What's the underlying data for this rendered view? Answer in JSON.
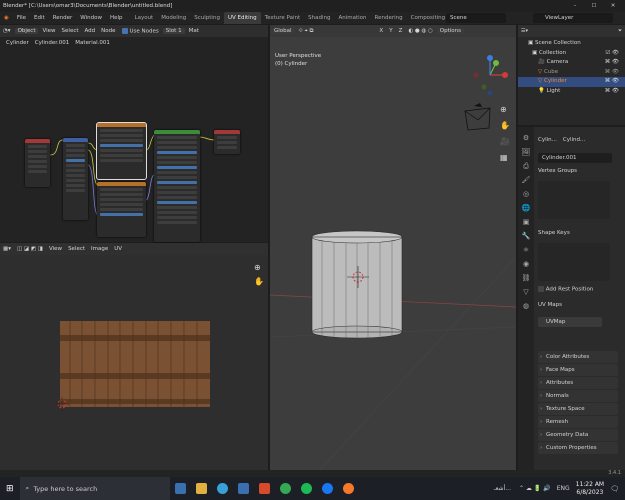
{
  "titlebar": {
    "title": "Blender* [C:\\Users\\omar3\\Documents\\Blender\\untitled.blend]"
  },
  "menu": [
    "File",
    "Edit",
    "Render",
    "Window",
    "Help"
  ],
  "workspaces": [
    "Layout",
    "Modeling",
    "Sculpting",
    "UV Editing",
    "Texture Paint",
    "Shading",
    "Animation",
    "Rendering",
    "Compositing"
  ],
  "scene": "Scene",
  "view_layer": "ViewLayer",
  "node_header": {
    "mode": "Object",
    "items": [
      "View",
      "Select",
      "Add",
      "Node"
    ],
    "use_nodes": "Use Nodes",
    "slot": "Slot 1",
    "mat": "Mat"
  },
  "breadcrumb": [
    "Cylinder",
    "Cylinder.001",
    "Material.001"
  ],
  "uv_header": {
    "items": [
      "View",
      "Select",
      "Image",
      "UV"
    ]
  },
  "viewport": {
    "title": "User Perspective",
    "object": "(0) Cylinder",
    "orientation": "Global",
    "options": "Options",
    "axes": [
      "X",
      "Y",
      "Z"
    ]
  },
  "outliner": {
    "collection_root": "Scene Collection",
    "collection": "Collection",
    "items": [
      "Camera",
      "Cube",
      "Cylinder",
      "Light"
    ]
  },
  "props": {
    "crumb": [
      "Cylin...",
      "Cylind..."
    ],
    "mesh_name": "Cylinder.001",
    "vertex_groups": "Vertex Groups",
    "shape_keys": "Shape Keys",
    "add_rest": "Add Rest Position",
    "uv_maps": "UV Maps",
    "uv_map_name": "UVMap",
    "panels": [
      "Color Attributes",
      "Face Maps",
      "Attributes",
      "Normals",
      "Texture Space",
      "Remesh",
      "Geometry Data",
      "Custom Properties"
    ]
  },
  "status": {
    "version": "3.4.1"
  },
  "taskbar": {
    "search": "Type here to search",
    "lang": "ENG",
    "time": "11:22 AM",
    "date": "6/8/2023",
    "weather": "أشعـ..."
  },
  "colors": {
    "accent": "#4772b3",
    "selected_row": "#334d80",
    "wood": "#7a5233"
  }
}
